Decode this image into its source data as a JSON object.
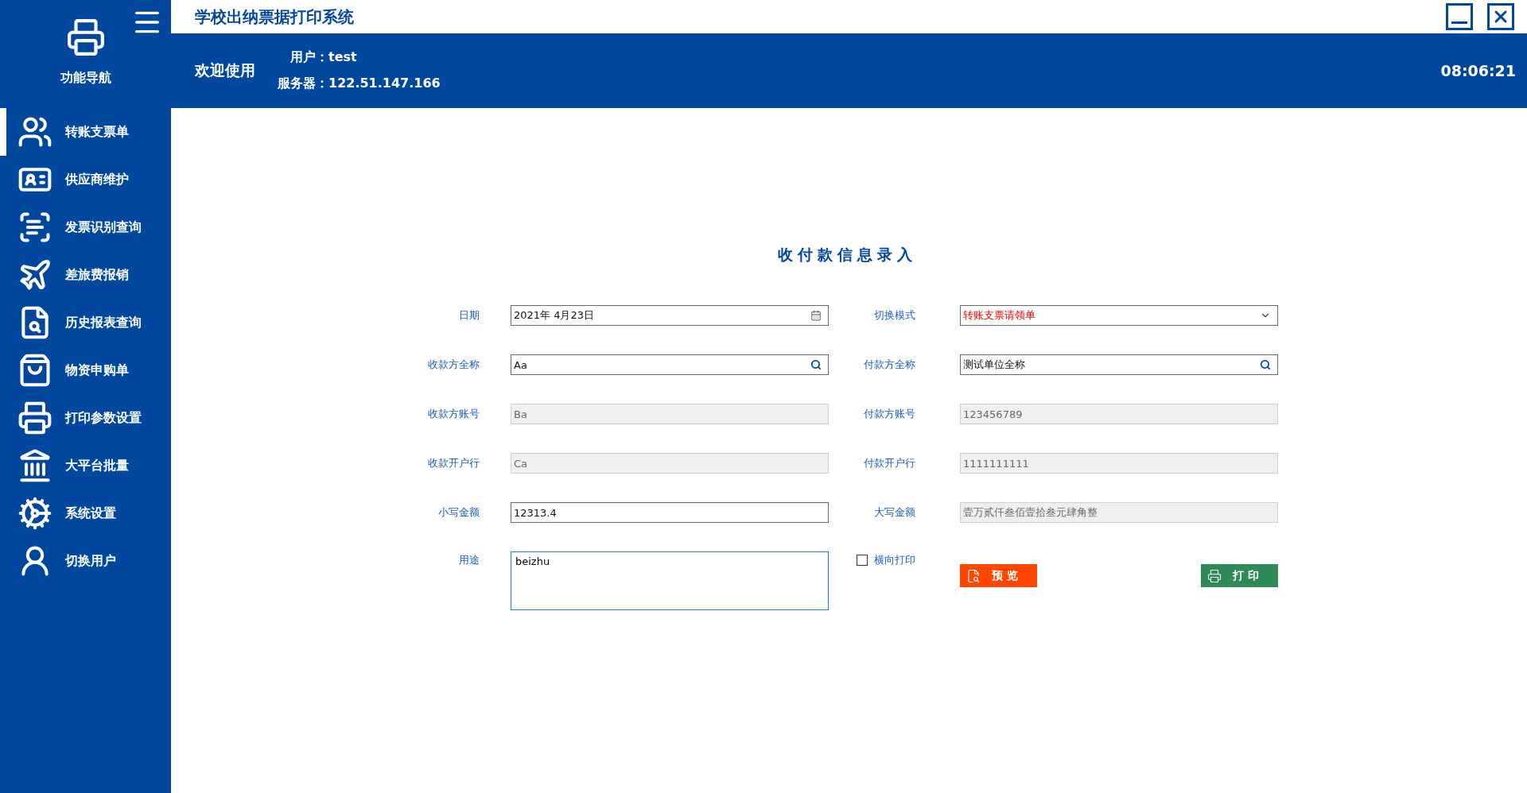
{
  "window": {
    "title": "学校出纳票据打印系统"
  },
  "sidebar": {
    "heading": "功能导航",
    "items": [
      {
        "label": "转账支票单",
        "selected": true
      },
      {
        "label": "供应商维护",
        "selected": false
      },
      {
        "label": "发票识别查询",
        "selected": false
      },
      {
        "label": "差旅费报销",
        "selected": false
      },
      {
        "label": "历史报表查询",
        "selected": false
      },
      {
        "label": "物资申购单",
        "selected": false
      },
      {
        "label": "打印参数设置",
        "selected": false
      },
      {
        "label": "大平台批量",
        "selected": false
      },
      {
        "label": "系统设置",
        "selected": false
      },
      {
        "label": "切换用户",
        "selected": false
      }
    ]
  },
  "header": {
    "welcome": "欢迎使用",
    "info": [
      {
        "label": "用户：",
        "value": "test"
      },
      {
        "label": "服务器：",
        "value": "122.51.147.166"
      }
    ],
    "time": "08:06:21"
  },
  "form": {
    "title": "收付款信息录入",
    "rows": [
      [
        {
          "label": "日期",
          "value": "2021年  4月23日",
          "kind": "date"
        },
        {
          "label": "切换模式",
          "value": "转账支票请领单",
          "kind": "select"
        }
      ],
      [
        {
          "label": "收款方全称",
          "value": "Aa",
          "kind": "search"
        },
        {
          "label": "付款方全称",
          "value": "测试单位全称",
          "kind": "search"
        }
      ],
      [
        {
          "label": "收款方账号",
          "value": "Ba",
          "kind": "readonly"
        },
        {
          "label": "付款方账号",
          "value": "123456789",
          "kind": "readonly"
        }
      ],
      [
        {
          "label": "收款开户行",
          "value": "Ca",
          "kind": "readonly"
        },
        {
          "label": "付款开户行",
          "value": "1111111111",
          "kind": "readonly"
        }
      ],
      [
        {
          "label": "小写金额",
          "value": "12313.4",
          "kind": "text"
        },
        {
          "label": "大写金额",
          "value": "壹万贰仟叁佰壹拾叁元肆角整",
          "kind": "readonly"
        }
      ]
    ],
    "purpose": {
      "label": "用途",
      "value": "beizhu"
    },
    "landscape": {
      "label": "横向打印",
      "checked": false
    },
    "buttons": [
      {
        "label": "预 览",
        "kind": "preview"
      },
      {
        "label": "打 印",
        "kind": "print"
      }
    ]
  }
}
